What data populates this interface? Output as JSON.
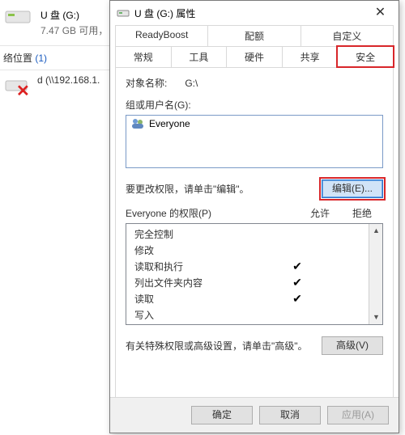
{
  "bg": {
    "drive_label": "U 盘 (G:)",
    "drive_sub": "7.47 GB 可用，",
    "net_label": "络位置",
    "net_count": "(1)",
    "net_item": "d (\\\\192.168.1."
  },
  "dialog": {
    "title": "U 盘 (G:) 属性",
    "close": "✕",
    "tabs_row1": [
      "ReadyBoost",
      "配额",
      "自定义"
    ],
    "tabs_row2": [
      "常规",
      "工具",
      "硬件",
      "共享",
      "安全"
    ],
    "object_label": "对象名称:",
    "object_value": "G:\\",
    "group_label": "组或用户名(G):",
    "group_item": "Everyone",
    "edit_hint": "要更改权限，请单击\"编辑\"。",
    "edit_btn": "编辑(E)...",
    "perm_label": "Everyone 的权限(P)",
    "perm_allow": "允许",
    "perm_deny": "拒绝",
    "perms": [
      {
        "name": "完全控制",
        "allow": false,
        "deny": false
      },
      {
        "name": "修改",
        "allow": false,
        "deny": false
      },
      {
        "name": "读取和执行",
        "allow": true,
        "deny": false
      },
      {
        "name": "列出文件夹内容",
        "allow": true,
        "deny": false
      },
      {
        "name": "读取",
        "allow": true,
        "deny": false
      },
      {
        "name": "写入",
        "allow": false,
        "deny": false
      }
    ],
    "adv_hint": "有关特殊权限或高级设置，请单击\"高级\"。",
    "adv_btn": "高级(V)",
    "ok": "确定",
    "cancel": "取消",
    "apply": "应用(A)"
  }
}
